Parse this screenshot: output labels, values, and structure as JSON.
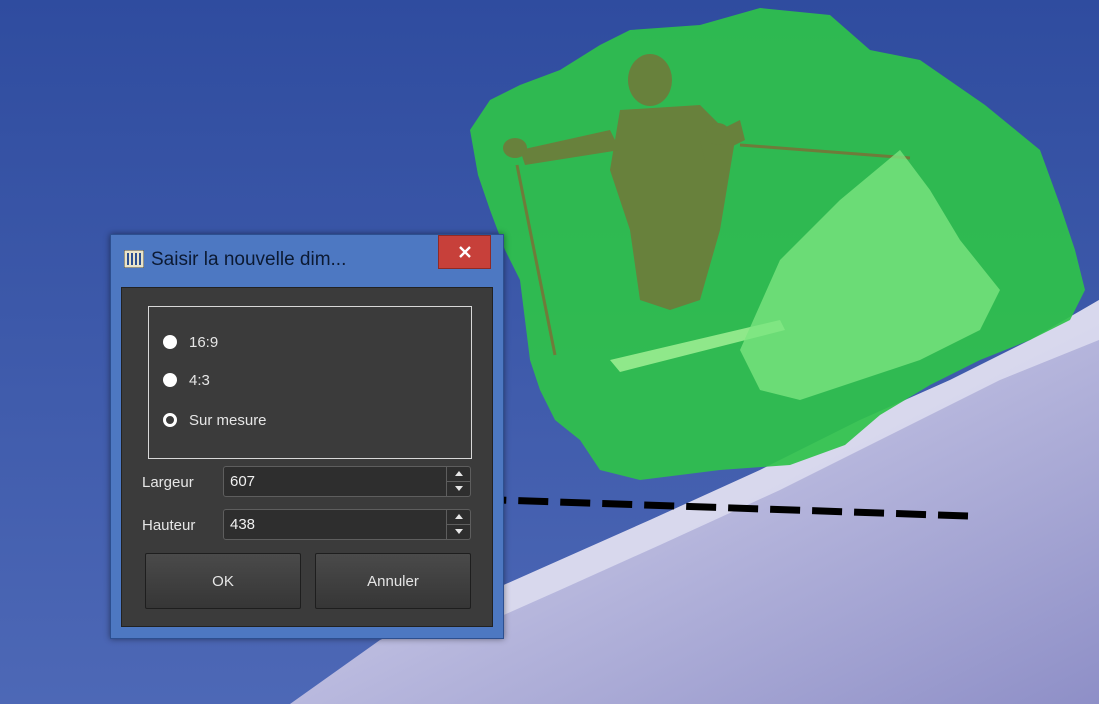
{
  "dialog": {
    "title": "Saisir la nouvelle dim...",
    "close_icon": "close-icon",
    "app_icon": "film-strip-icon",
    "aspect_options": [
      {
        "label": "16:9",
        "checked": false
      },
      {
        "label": "4:3",
        "checked": false
      },
      {
        "label": "Sur mesure",
        "checked": true
      }
    ],
    "width_label": "Largeur",
    "width_value": "607",
    "height_label": "Hauteur",
    "height_value": "438",
    "ok_label": "OK",
    "cancel_label": "Annuler"
  },
  "colors": {
    "selection_overlay": "#2fc24a",
    "titlebar": "#4d78c2",
    "close_button": "#c7403a",
    "dialog_body": "#3b3b3b"
  }
}
